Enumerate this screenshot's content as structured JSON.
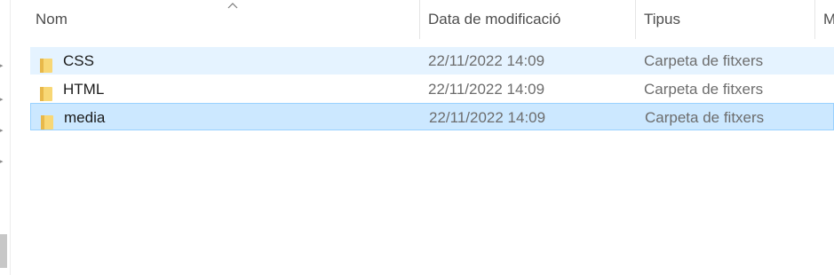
{
  "columns": {
    "name": "Nom",
    "date": "Data de modificació",
    "type": "Tipus",
    "size_truncated": "M"
  },
  "files": [
    {
      "name": "CSS",
      "date": "22/11/2022 14:09",
      "type": "Carpeta de fitxers",
      "icon": "folder-icon",
      "state": "hover"
    },
    {
      "name": "HTML",
      "date": "22/11/2022 14:09",
      "type": "Carpeta de fitxers",
      "icon": "folder-icon",
      "state": "normal"
    },
    {
      "name": "media",
      "date": "22/11/2022 14:09",
      "type": "Carpeta de fitxers",
      "icon": "folder-icon",
      "state": "selected"
    }
  ],
  "colors": {
    "hover": "#e5f3ff",
    "selected": "#cce8ff",
    "selected_border": "#99d1ff",
    "folder": "#f8d775"
  }
}
